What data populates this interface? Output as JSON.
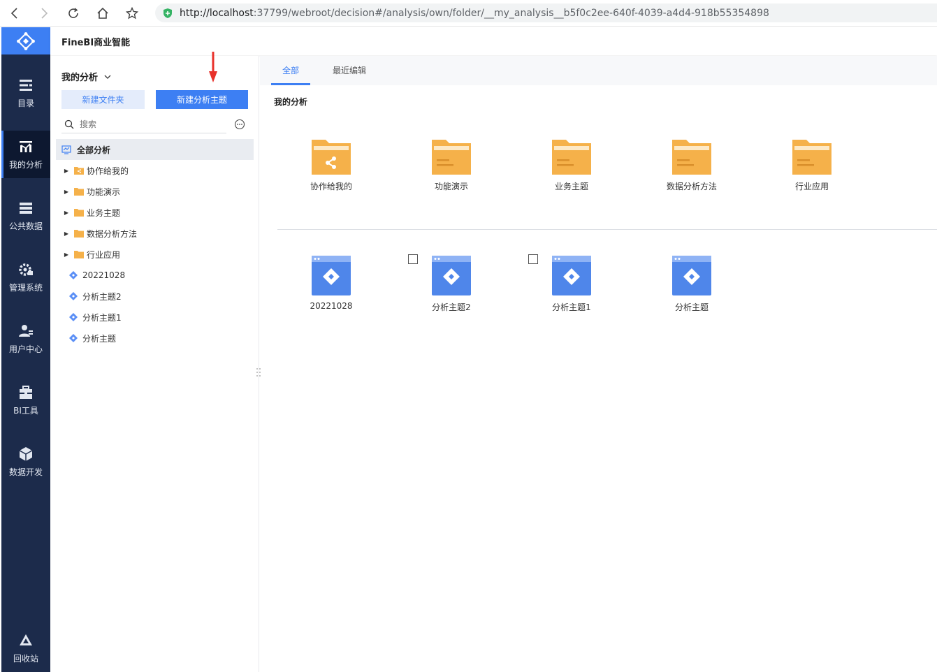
{
  "browser": {
    "url_host": "http://localhost",
    "url_rest": ":37799/webroot/decision#/analysis/own/folder/__my_analysis__b5f0c2ee-640f-4039-a4d4-918b55354898"
  },
  "app": {
    "title": "FineBI商业智能"
  },
  "side_nav": {
    "items": [
      {
        "label": "目录",
        "icon": "catalog-icon"
      },
      {
        "label": "我的分析",
        "icon": "my-analysis-icon",
        "active": true
      },
      {
        "label": "公共数据",
        "icon": "public-data-icon"
      },
      {
        "label": "管理系统",
        "icon": "gear-icon"
      },
      {
        "label": "用户中心",
        "icon": "user-icon"
      },
      {
        "label": "BI工具",
        "icon": "toolbox-icon"
      },
      {
        "label": "数据开发",
        "icon": "cube-icon"
      },
      {
        "label": "回收站",
        "icon": "recycle-icon"
      }
    ]
  },
  "panel": {
    "title": "我的分析",
    "new_folder": "新建文件夹",
    "new_subject": "新建分析主题",
    "search_placeholder": "搜索",
    "root": "全部分析",
    "tree": [
      {
        "label": "协作给我的",
        "type": "shared-folder"
      },
      {
        "label": "功能演示",
        "type": "folder"
      },
      {
        "label": "业务主题",
        "type": "folder"
      },
      {
        "label": "数据分析方法",
        "type": "folder"
      },
      {
        "label": "行业应用",
        "type": "folder"
      },
      {
        "label": "20221028",
        "type": "subject"
      },
      {
        "label": "分析主题2",
        "type": "subject"
      },
      {
        "label": "分析主题1",
        "type": "subject"
      },
      {
        "label": "分析主题",
        "type": "subject"
      }
    ]
  },
  "tabs": [
    {
      "label": "全部"
    },
    {
      "label": "最近编辑"
    }
  ],
  "main": {
    "section_title": "我的分析",
    "folders": [
      "协作给我的",
      "功能演示",
      "业务主题",
      "数据分析方法",
      "行业应用"
    ],
    "subjects": [
      "20221028",
      "分析主题2",
      "分析主题1",
      "分析主题"
    ]
  },
  "colors": {
    "accent": "#3d7ff3",
    "sidebar": "#1c2b4b",
    "folder": "#f5b14a",
    "annotation_arrow": "#e8312a"
  }
}
